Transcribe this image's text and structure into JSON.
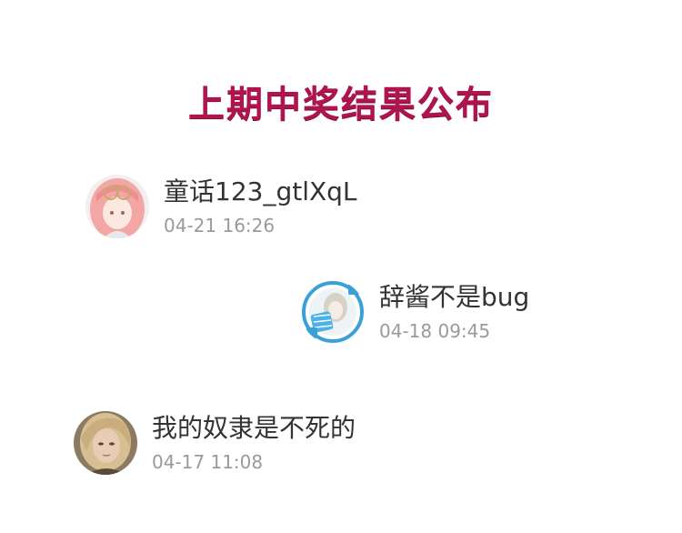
{
  "banner": {
    "title": "上期中奖结果公布",
    "color": "#b0144f"
  },
  "winners": [
    {
      "username": "童话123_gtlXqL",
      "timestamp": "04-21 16:26",
      "avatar_icon": "anime-girl-pink-hair-avatar"
    },
    {
      "username": "辞酱不是bug",
      "timestamp": "04-18 09:45",
      "avatar_icon": "anime-girl-blue-frame-avatar"
    },
    {
      "username": "我的奴隶是不死的",
      "timestamp": "04-17 11:08",
      "avatar_icon": "blonde-portrait-avatar"
    }
  ]
}
